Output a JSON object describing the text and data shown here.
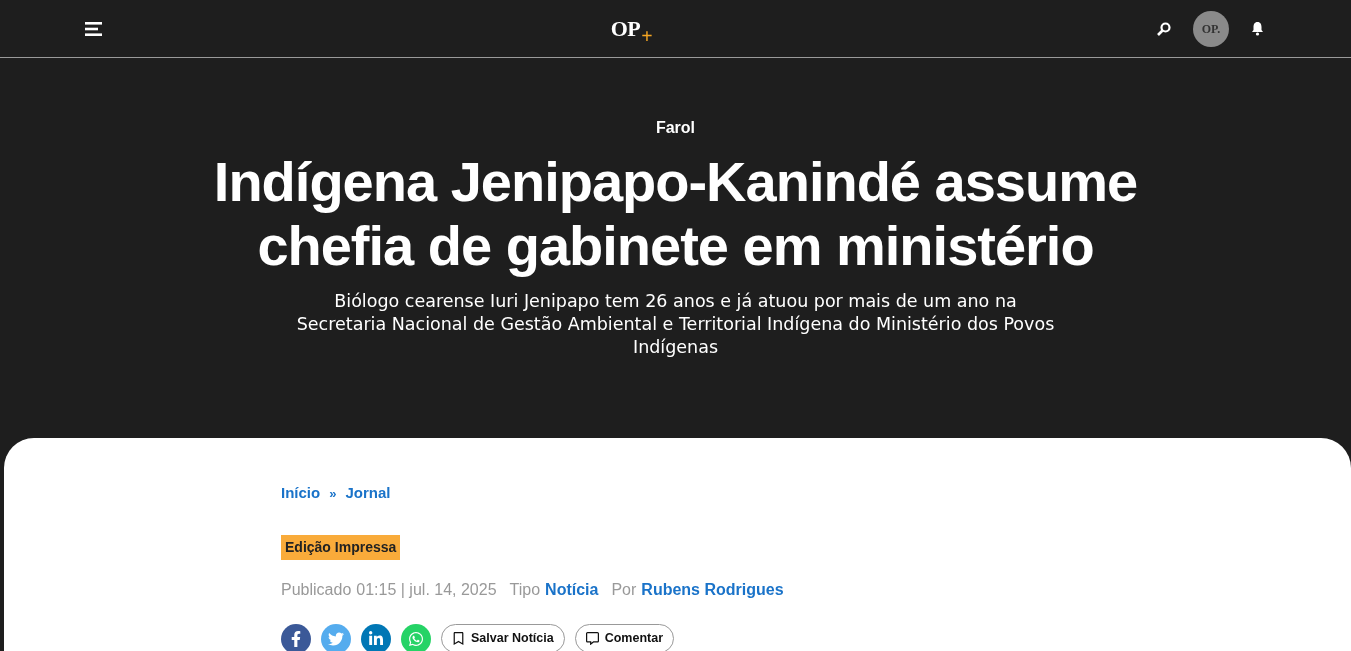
{
  "header": {
    "logo": "OP",
    "logo_mark": "+",
    "avatar": "OP."
  },
  "article": {
    "section": "Farol",
    "title": "Indígena Jenipapo-Kanindé assume chefia de gabinete em ministério",
    "subtitle": "Biólogo cearense Iuri Jenipapo tem 26 anos e já atuou por mais de um ano na Secretaria Nacional de Gestão Ambiental e Territorial Indígena do Ministério dos Povos Indígenas"
  },
  "breadcrumb": {
    "items": [
      "Início",
      "Jornal"
    ],
    "separator": "»"
  },
  "tag": "Edição Impressa",
  "meta": {
    "published_label": "Publicado",
    "published": "01:15 | jul. 14, 2025",
    "type_label": "Tipo",
    "type": "Notícia",
    "author_label": "Por",
    "author": "Rubens Rodrigues"
  },
  "share": [
    {
      "kind": "facebook"
    },
    {
      "kind": "twitter"
    },
    {
      "kind": "linkedin"
    },
    {
      "kind": "whatsapp"
    }
  ],
  "actions": [
    {
      "kind": "bookmark",
      "label": "Salvar Notícia"
    },
    {
      "kind": "comment",
      "label": "Comentar"
    }
  ]
}
